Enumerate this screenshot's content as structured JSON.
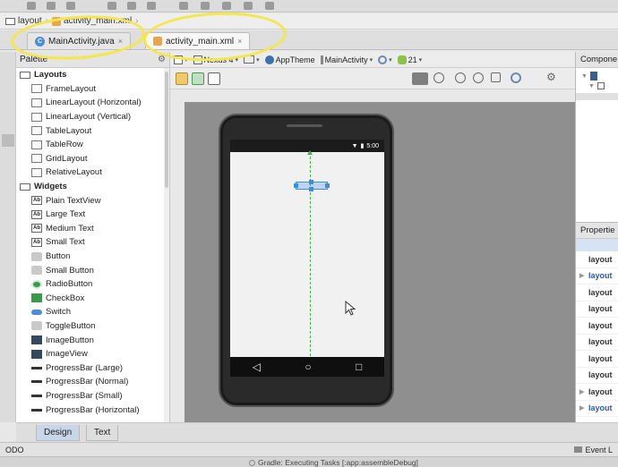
{
  "colors": {
    "annotation": "#f5e64a",
    "accent": "#3a8ede",
    "guide": "#3db34a"
  },
  "breadcrumb": {
    "items": [
      {
        "label": "layout",
        "icon": "folder-icon"
      },
      {
        "label": "activity_main.xml",
        "icon": "xml-file-icon"
      }
    ]
  },
  "tabs": [
    {
      "label": "MainActivity.java",
      "icon": "java-class-icon",
      "active": false
    },
    {
      "label": "activity_main.xml",
      "icon": "xml-file-icon",
      "active": true
    }
  ],
  "palette": {
    "title": "Palette",
    "groups": [
      {
        "label": "Layouts",
        "items": [
          "FrameLayout",
          "LinearLayout (Horizontal)",
          "LinearLayout (Vertical)",
          "TableLayout",
          "TableRow",
          "GridLayout",
          "RelativeLayout"
        ]
      },
      {
        "label": "Widgets",
        "items": [
          "Plain TextView",
          "Large Text",
          "Medium Text",
          "Small Text",
          "Button",
          "Small Button",
          "RadioButton",
          "CheckBox",
          "Switch",
          "ToggleButton",
          "ImageButton",
          "ImageView",
          "ProgressBar (Large)",
          "ProgressBar (Normal)",
          "ProgressBar (Small)",
          "ProgressBar (Horizontal)"
        ]
      }
    ]
  },
  "editor_toolbar": {
    "device": "Nexus 4",
    "theme": "AppTheme",
    "activity": "MainActivity",
    "api": "21"
  },
  "device": {
    "status_time": "5:00"
  },
  "component_tree": {
    "title": "Compone"
  },
  "properties": {
    "title": "Propertie",
    "rows": [
      {
        "label": "layout",
        "blue": false,
        "expandable": false
      },
      {
        "label": "layout",
        "blue": true,
        "expandable": true
      },
      {
        "label": "layout",
        "blue": false,
        "expandable": false
      },
      {
        "label": "layout",
        "blue": false,
        "expandable": false
      },
      {
        "label": "layout",
        "blue": false,
        "expandable": false
      },
      {
        "label": "layout",
        "blue": false,
        "expandable": false
      },
      {
        "label": "layout",
        "blue": false,
        "expandable": false
      },
      {
        "label": "layout",
        "blue": false,
        "expandable": false
      },
      {
        "label": "layout",
        "blue": false,
        "expandable": true
      },
      {
        "label": "layout",
        "blue": true,
        "expandable": true
      }
    ]
  },
  "mode_tabs": [
    {
      "label": "Design",
      "active": true
    },
    {
      "label": "Text",
      "active": false
    }
  ],
  "bottom": {
    "left_label": "ODO",
    "event_log": "Event L",
    "status": "Gradle: Executing Tasks [:app:assembleDebug]"
  }
}
